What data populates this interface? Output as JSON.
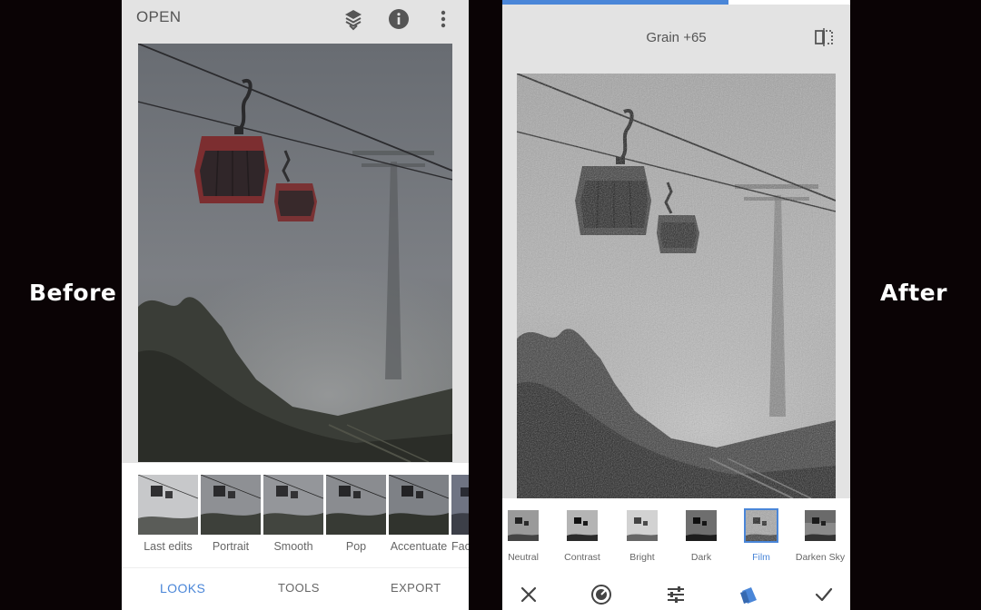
{
  "labels": {
    "before": "Before",
    "after": "After"
  },
  "left_screen": {
    "top_bar": {
      "open_label": "OPEN",
      "icons": [
        "layers-icon",
        "info-icon",
        "more-vertical-icon"
      ]
    },
    "looks": [
      {
        "label": "Last edits"
      },
      {
        "label": "Portrait"
      },
      {
        "label": "Smooth"
      },
      {
        "label": "Pop"
      },
      {
        "label": "Accentuate"
      },
      {
        "label": "Fac"
      }
    ],
    "nav": {
      "looks": "LOOKS",
      "tools": "TOOLS",
      "export": "EXPORT",
      "active": "LOOKS"
    }
  },
  "right_screen": {
    "progress_fraction": 0.65,
    "grain_label": "Grain +65",
    "styles": [
      {
        "label": "Neutral",
        "selected": false
      },
      {
        "label": "Contrast",
        "selected": false
      },
      {
        "label": "Bright",
        "selected": false
      },
      {
        "label": "Dark",
        "selected": false
      },
      {
        "label": "Film",
        "selected": true
      },
      {
        "label": "Darken Sky",
        "selected": false
      }
    ],
    "bottom_icons": [
      "close-icon",
      "effect-dial-icon",
      "sliders-icon",
      "styles-icon",
      "check-icon"
    ]
  },
  "colors": {
    "accent": "#4a86d8",
    "panel": "#e3e3e3",
    "background": "#0a0305"
  }
}
